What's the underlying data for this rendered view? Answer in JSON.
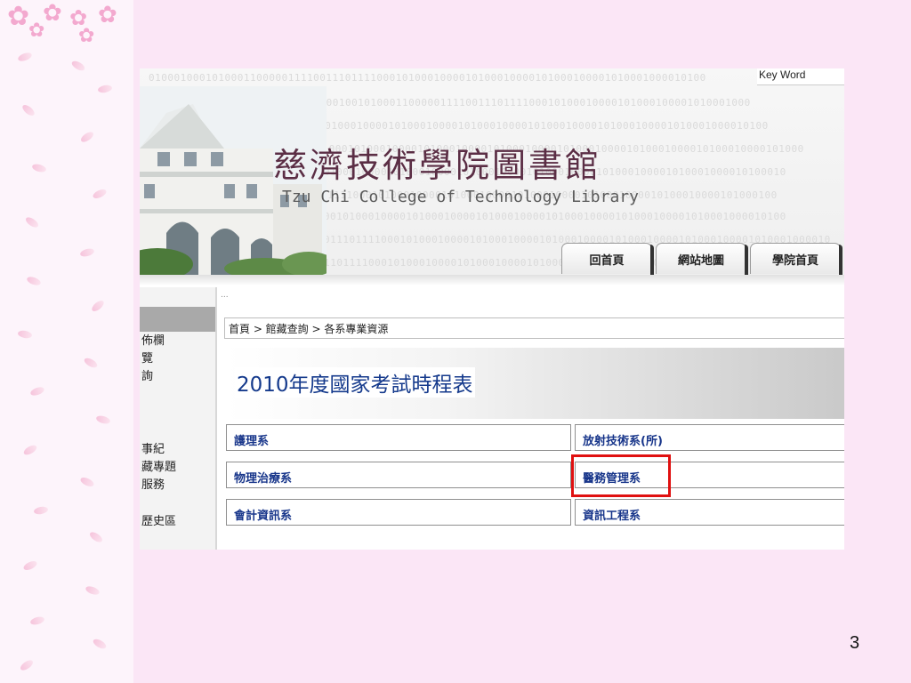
{
  "slide": {
    "number": "3"
  },
  "header": {
    "library_title_cn": "慈濟技術學院圖書館",
    "library_title_en": "Tzu Chi College of Technology Library",
    "keyword_label": "Key Word",
    "binary_lines": [
      "0100010001010001100000111100111011110001010001000010100010000101000100001010001000010100",
      "1000100001000101000100010010100011000001111001110111100010100010000101000100001010001000",
      "0100001010001000010100010000101000100001010001000010100010000101000100001010001000010100",
      "1110011101111000101000100001010001000010100010000101000100001010001000010100010000101000",
      "0001010001000010100010000101000100001010001000010100010000101000100001010001000010100010",
      "1100000111100111011110001010001000010100010000101000100001010001000010100010000101000100",
      "0100001010001000010100010000101000100001010001000010100010000101000100001010001000010100",
      "0001111001110111100010100010000101000100001010001000010100010000101000100001010001000010",
      "1110111100010100010000101000100001010001000010100010000101000100001010001000010100010000"
    ]
  },
  "nav_tabs": [
    "回首頁",
    "網站地圖",
    "學院首頁"
  ],
  "sidebar": {
    "items": [
      "佈欄",
      "覽",
      "詢",
      "事紀",
      "藏專題",
      "服務",
      "歷史區"
    ]
  },
  "content": {
    "dots": "...",
    "breadcrumb": "首頁 > 館藏查詢 > 各系專業資源",
    "title": "2010年度國家考試時程表",
    "departments": [
      [
        "護理系",
        "放射技術系(所)"
      ],
      [
        "物理治療系",
        "醫務管理系"
      ],
      [
        "會計資訊系",
        "資訊工程系"
      ]
    ]
  },
  "colors": {
    "slide_background": "#fbe6f6",
    "link": "#17358a",
    "title": "#153a8c",
    "highlight": "#e01010"
  }
}
